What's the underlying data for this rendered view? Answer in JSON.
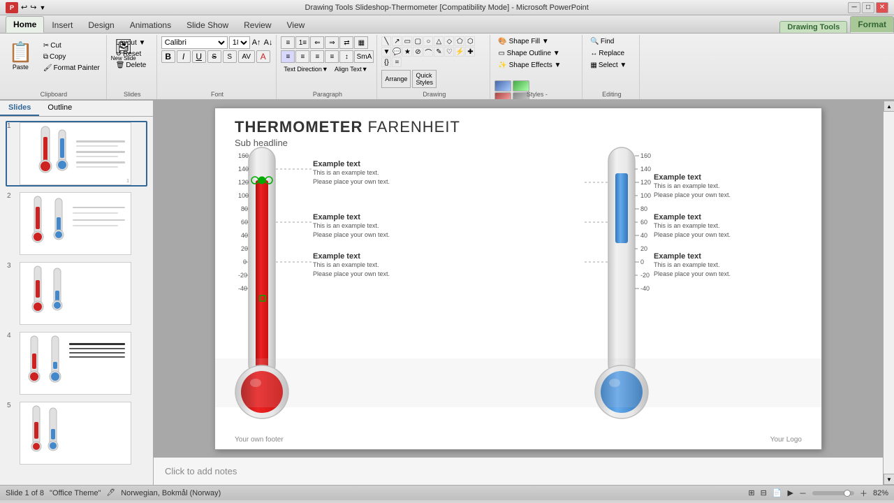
{
  "titlebar": {
    "title": "Drawing Tools   Slideshop-Thermometer [Compatibility Mode] - Microsoft PowerPoint",
    "logo_text": "PP",
    "quick_access": [
      "↩",
      "↪",
      "▼"
    ]
  },
  "tabs": {
    "contextual_label": "Drawing Tools",
    "items": [
      "Home",
      "Insert",
      "Design",
      "Animations",
      "Slide Show",
      "Review",
      "View",
      "Format"
    ]
  },
  "ribbon": {
    "clipboard": {
      "label": "Clipboard",
      "paste": "Paste",
      "cut": "Cut",
      "copy": "Copy",
      "format_painter": "Format Painter"
    },
    "slides": {
      "label": "Slides",
      "layout": "Layout ▼",
      "reset": "Reset",
      "new_slide": "New\nSlide",
      "delete": "Delete"
    },
    "font": {
      "label": "Font",
      "family": "Calibri",
      "size": "18",
      "bold": "B",
      "italic": "I",
      "underline": "U",
      "strikethrough": "abc",
      "shadow": "S",
      "clear": "A"
    },
    "paragraph": {
      "label": "Paragraph"
    },
    "drawing": {
      "label": "Drawing"
    },
    "styles": {
      "label": "Styles -"
    },
    "editing": {
      "label": "Editing",
      "find": "Find",
      "replace": "Replace",
      "select": "Select ▼"
    }
  },
  "slides_panel": {
    "tabs": [
      "Slides",
      "Outline"
    ],
    "slides": [
      {
        "num": "1",
        "selected": true
      },
      {
        "num": "2"
      },
      {
        "num": "3"
      },
      {
        "num": "4"
      },
      {
        "num": "5"
      }
    ]
  },
  "slide": {
    "title": "THERMOMETER",
    "title_rest": " FARENHEIT",
    "subtitle": "Sub headline",
    "footer_left": "Your own footer",
    "footer_right": "Your Logo",
    "left_therm": {
      "scale": [
        160,
        140,
        120,
        100,
        80,
        60,
        40,
        20,
        0,
        -20,
        -40
      ],
      "callouts": [
        {
          "y_label": 140,
          "title": "Example text",
          "body": "This is an example text.\nPlease place your own text."
        },
        {
          "y_label": 80,
          "title": "Example text",
          "body": "This is an example text.\nPlease place your own text."
        },
        {
          "y_label": 20,
          "title": "Example text",
          "body": "This is an example text.\nPlease place your own text."
        }
      ]
    },
    "right_therm": {
      "scale": [
        160,
        140,
        120,
        100,
        80,
        60,
        40,
        20,
        0,
        -20,
        -40
      ],
      "callouts": [
        {
          "y_label": 120,
          "title": "Example text",
          "body": "This is an example text.\nPlease place your own text."
        },
        {
          "y_label": 60,
          "title": "Example text",
          "body": "This is an example text.\nPlease place your own text."
        },
        {
          "y_label": 0,
          "title": "Example text",
          "body": "This is an example text.\nPlease place your own text."
        }
      ]
    }
  },
  "notes": {
    "placeholder": "Click to add notes"
  },
  "statusbar": {
    "slide_info": "Slide 1 of 8",
    "theme": "\"Office Theme\"",
    "language": "Norwegian, Bokmål (Norway)",
    "zoom": "82%"
  },
  "colors": {
    "red_fill": "#cc2222",
    "blue_fill": "#4488cc",
    "therm_bg": "#e8e8e8",
    "selected_border": "#336699",
    "ribbon_bg": "#f0f0f0",
    "contextual_tab": "#c8e0c0",
    "accent_green": "#336633"
  }
}
